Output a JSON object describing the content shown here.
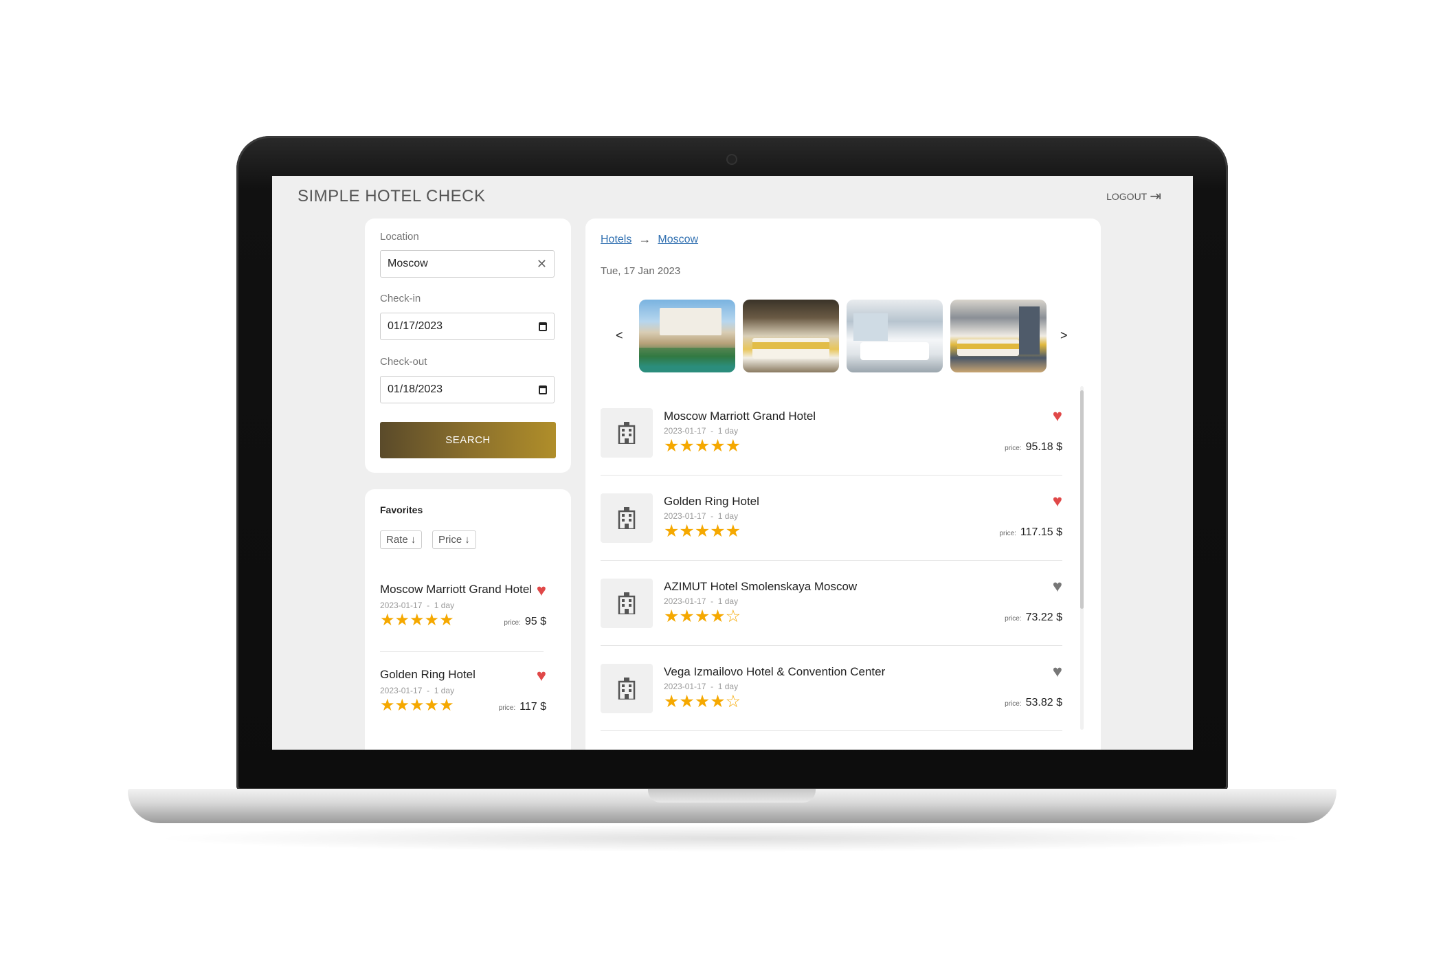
{
  "app": {
    "title": "SIMPLE HOTEL CHECK",
    "logout_label": "LOGOUT"
  },
  "search": {
    "location_label": "Location",
    "location_value": "Moscow",
    "checkin_label": "Check-in",
    "checkin_value": "01/17/2023",
    "checkout_label": "Check-out",
    "checkout_value": "01/18/2023",
    "search_button": "SEARCH"
  },
  "favorites": {
    "title": "Favorites",
    "sort_rate": "Rate",
    "sort_price": "Price",
    "items": [
      {
        "name": "Moscow Marriott Grand Hotel",
        "date": "2023-01-17",
        "sep": "-",
        "duration": "1 day",
        "stars": 5,
        "stars_text": "★★★★★",
        "price_label": "price:",
        "price": "95 $",
        "heart": "♥"
      },
      {
        "name": "Golden Ring Hotel",
        "date": "2023-01-17",
        "sep": "-",
        "duration": "1 day",
        "stars": 5,
        "stars_text": "★★★★★",
        "price_label": "price:",
        "price": "117 $",
        "heart": "♥"
      }
    ]
  },
  "results": {
    "breadcrumb": {
      "root": "Hotels",
      "current": "Moscow"
    },
    "date": "Tue, 17 Jan 2023",
    "carousel": {
      "prev": "<",
      "next": ">"
    },
    "hotels": [
      {
        "name": "Moscow Marriott Grand Hotel",
        "date": "2023-01-17",
        "sep": "-",
        "duration": "1 day",
        "stars": 5,
        "stars_text": "★★★★★",
        "price_label": "price:",
        "price": "95.18 $",
        "favorite": true,
        "heart": "♥"
      },
      {
        "name": "Golden Ring Hotel",
        "date": "2023-01-17",
        "sep": "-",
        "duration": "1 day",
        "stars": 5,
        "stars_text": "★★★★★",
        "price_label": "price:",
        "price": "117.15 $",
        "favorite": true,
        "heart": "♥"
      },
      {
        "name": "AZIMUT Hotel Smolenskaya Moscow",
        "date": "2023-01-17",
        "sep": "-",
        "duration": "1 day",
        "stars": 4,
        "stars_text": "★★★★☆",
        "price_label": "price:",
        "price": "73.22 $",
        "favorite": false,
        "heart": "♥"
      },
      {
        "name": "Vega Izmailovo Hotel & Convention Center",
        "date": "2023-01-17",
        "sep": "-",
        "duration": "1 day",
        "stars": 4,
        "stars_text": "★★★★☆",
        "price_label": "price:",
        "price": "53.82 $",
        "favorite": false,
        "heart": "♥"
      }
    ]
  },
  "colors": {
    "accent_gold": "#8a6f2c",
    "heart_active": "#e04848",
    "heart_inactive": "#777777",
    "star": "#f5a800",
    "link": "#2f6fb0"
  },
  "icons": {
    "logout": "logout-icon",
    "clear": "close-icon",
    "calendar": "calendar-icon",
    "hotel": "building-icon",
    "favorite": "heart-icon",
    "star": "star-icon"
  }
}
